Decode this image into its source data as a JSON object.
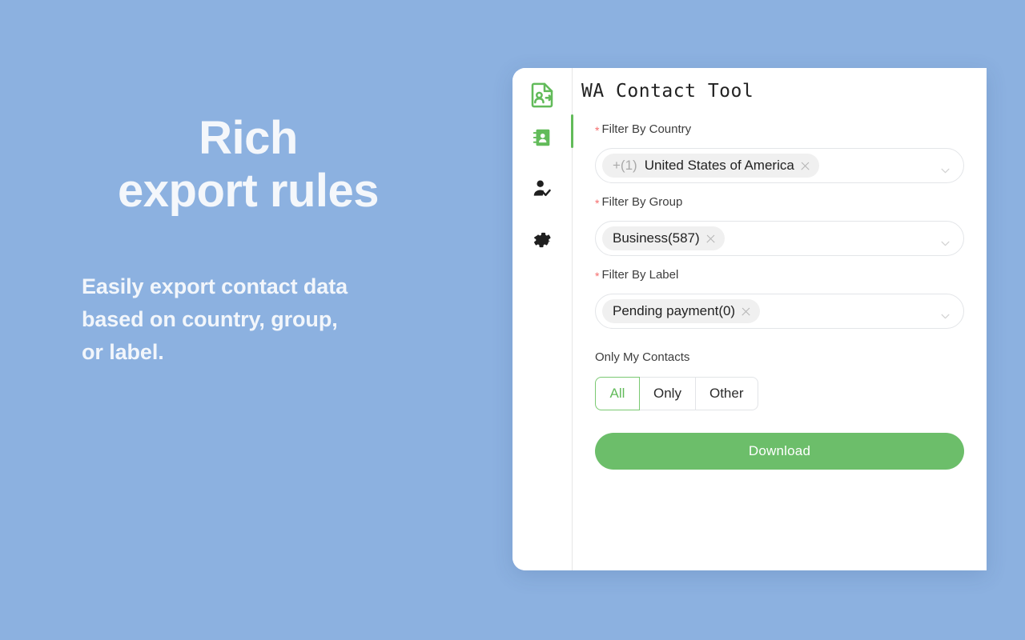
{
  "theme": {
    "page_background": "#8CB1E0",
    "accent_green": "#62BB5A",
    "button_green": "#6CBE6A",
    "required_red": "#F56C6C",
    "card_background": "#FFFFFF"
  },
  "promo": {
    "headline_line1": "Rich",
    "headline_line2": "export rules",
    "sub_line1": "Easily export contact data",
    "sub_line2": "based on country, group,",
    "sub_line3": "or label."
  },
  "app": {
    "title": "WA Contact Tool",
    "logo_icon": "contact-export-icon",
    "sidebar": {
      "items": [
        {
          "icon": "contact-book-icon",
          "active": true
        },
        {
          "icon": "user-check-icon",
          "active": false
        },
        {
          "icon": "gear-icon",
          "active": false
        }
      ]
    },
    "fields": [
      {
        "key": "country",
        "label": "Filter By Country",
        "required": true,
        "required_marker": "*",
        "tag_prefix": "+(1)",
        "tag_text": "United States of America",
        "close_icon": "close-icon",
        "arrow_icon": "chevron-down-icon"
      },
      {
        "key": "group",
        "label": "Filter By Group",
        "required": true,
        "required_marker": "*",
        "tag_prefix": "",
        "tag_text": "Business(587)",
        "close_icon": "close-icon",
        "arrow_icon": "chevron-down-icon"
      },
      {
        "key": "label",
        "label": "Filter By Label",
        "required": true,
        "required_marker": "*",
        "tag_prefix": "",
        "tag_text": "Pending payment(0)",
        "close_icon": "close-icon",
        "arrow_icon": "chevron-down-icon"
      }
    ],
    "only_my_contacts": {
      "label": "Only My Contacts",
      "options": [
        {
          "label": "All",
          "selected": true
        },
        {
          "label": "Only",
          "selected": false
        },
        {
          "label": "Other",
          "selected": false
        }
      ]
    },
    "download_label": "Download"
  }
}
